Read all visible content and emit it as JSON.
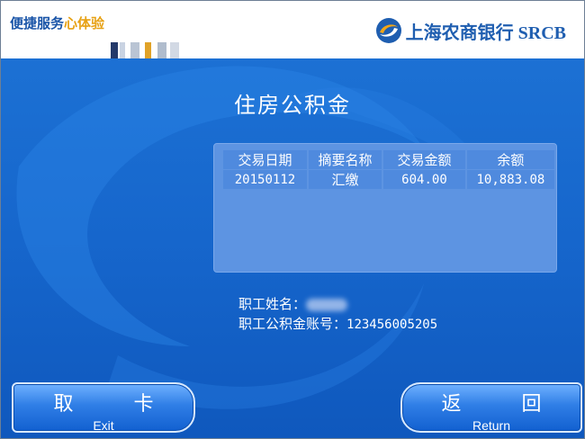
{
  "header": {
    "slogan_main": "便捷服务",
    "slogan_accent": "心体验",
    "bank_name": "上海农商银行 SRCB"
  },
  "page": {
    "title": "住房公积金"
  },
  "transactions": {
    "columns": [
      "交易日期",
      "摘要名称",
      "交易金额",
      "余额"
    ],
    "rows": [
      {
        "date": "20150112",
        "summary": "汇缴",
        "amount": "604.00",
        "balance": "10,883.08"
      }
    ]
  },
  "employee": {
    "name_label": "职工姓名：",
    "account_label": "职工公积金账号：",
    "account_value": "123456005205"
  },
  "buttons": {
    "exit_cn": "取 卡",
    "exit_en": "Exit",
    "return_cn": "返 回",
    "return_en": "Return"
  },
  "colors": {
    "background": "#1666cc",
    "accent": "#e7a114",
    "brand": "#1f5eb0"
  }
}
